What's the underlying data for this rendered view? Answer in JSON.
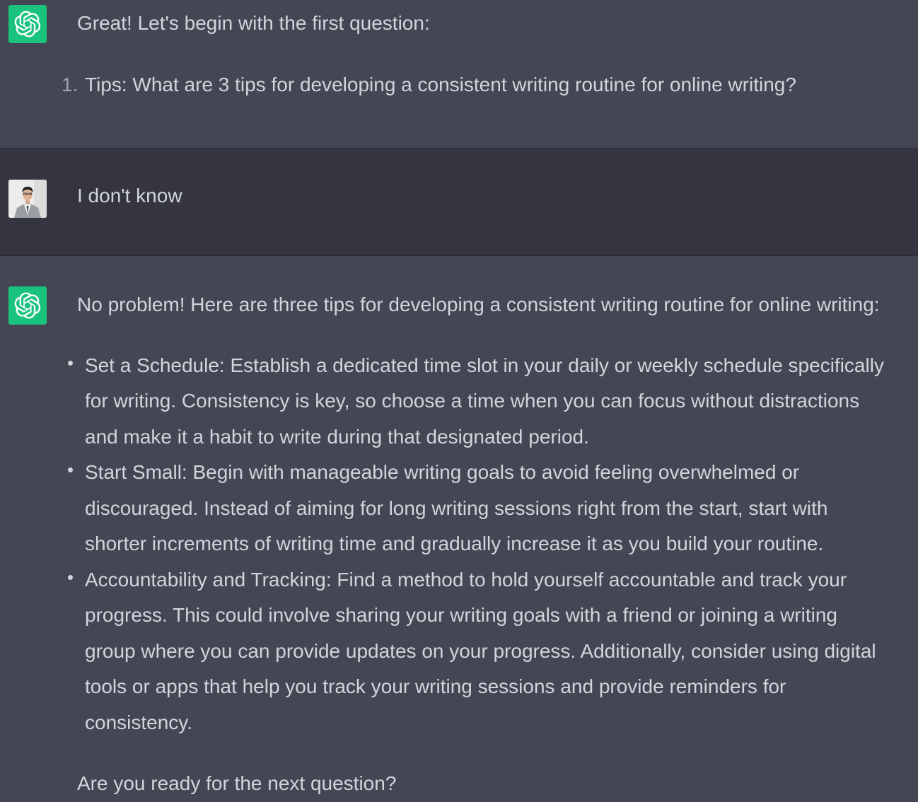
{
  "messages": {
    "m1": {
      "intro": "Great! Let's begin with the first question:",
      "list_marker": "1.",
      "list_item": "Tips: What are 3 tips for developing a consistent writing routine for online writing?"
    },
    "m2": {
      "text": "I don't know"
    },
    "m3": {
      "intro": "No problem! Here are three tips for developing a consistent writing routine for online writing:",
      "tips": [
        {
          "lines": [
            "Set a Schedule: Establish a dedicated time slot in your daily or weekly schedule specifically",
            "for writing. Consistency is key, so choose a time when you can focus without distractions",
            "and make it a habit to write during that designated period."
          ]
        },
        {
          "lines": [
            "Start Small: Begin with manageable writing goals to avoid feeling overwhelmed or",
            "discouraged. Instead of aiming for long writing sessions right from the start, start with",
            "shorter increments of writing time and gradually increase it as you build your routine."
          ]
        },
        {
          "lines": [
            "Accountability and Tracking: Find a method to hold yourself accountable and track your",
            "progress. This could involve sharing your writing goals with a friend or joining a writing",
            "group where you can provide updates on your progress. Additionally, consider using digital",
            "tools or apps that help you track your writing sessions and provide reminders for",
            "consistency."
          ]
        }
      ],
      "outro": "Are you ready for the next question?"
    }
  },
  "icons": {
    "assistant_avatar": "openai-logo-icon",
    "user_avatar": "user-photo-avatar"
  },
  "colors": {
    "assistant_bg": "#444654",
    "user_bg": "#343541",
    "gpt_green": "#19c37d",
    "text": "#d1d5db"
  }
}
